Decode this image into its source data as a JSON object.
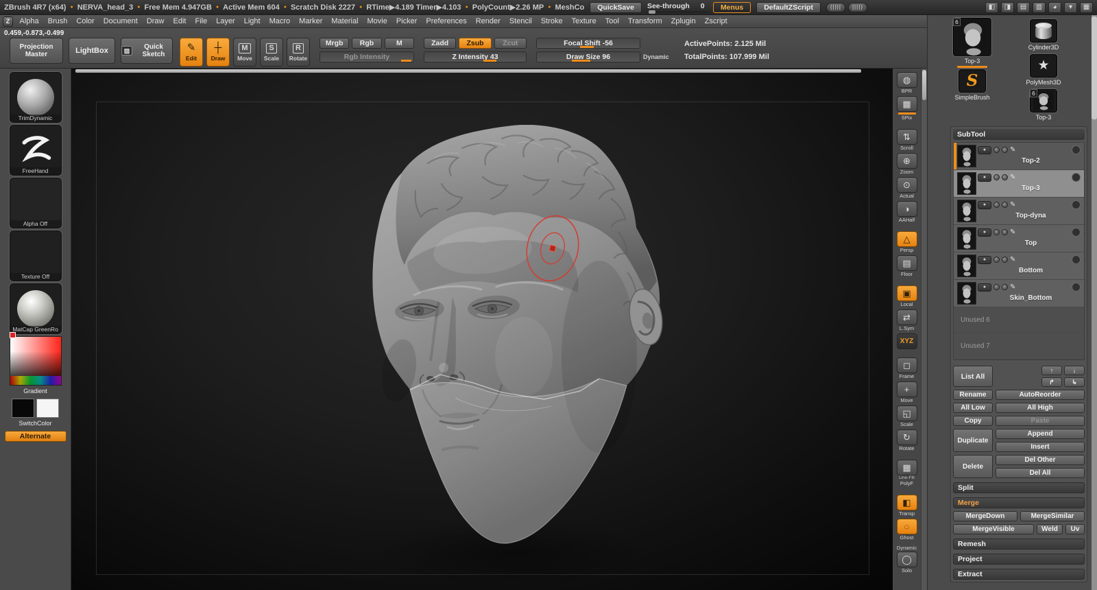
{
  "colors": {
    "accent": "#ef8f1c",
    "cursor_red": "#d63a2c"
  },
  "title_bar": {
    "stats": [
      "ZBrush 4R7 (x64)",
      "NERVA_head_3",
      "Free Mem 4.947GB",
      "Active Mem 604",
      "Scratch Disk 2227",
      "RTime▶4.189 Timer▶4.103",
      "PolyCount▶2.26 MP",
      "MeshCo"
    ],
    "stat_separator": "●",
    "quicksave": "QuickSave",
    "see_through_label": "See-through",
    "see_through_value": "0",
    "menus": "Menus",
    "default_zscript": "DefaultZScript",
    "zscript_sliders": [
      "(||||",
      "||||)"
    ]
  },
  "window_icons": [
    {
      "name": "document-new-icon",
      "glyph": "◧"
    },
    {
      "name": "document-save-icon",
      "glyph": "◨"
    },
    {
      "name": "document-open-icon",
      "glyph": "▤"
    },
    {
      "name": "document-export-icon",
      "glyph": "▥"
    },
    {
      "name": "material-sphere-icon",
      "glyph": "◕"
    },
    {
      "name": "collapse-tray-icon",
      "glyph": "▾"
    },
    {
      "name": "grid-icon",
      "glyph": "▦"
    }
  ],
  "menu_bar": {
    "logo_glyph": "Z",
    "items": [
      "Alpha",
      "Brush",
      "Color",
      "Document",
      "Draw",
      "Edit",
      "File",
      "Layer",
      "Light",
      "Macro",
      "Marker",
      "Material",
      "Movie",
      "Picker",
      "Preferences",
      "Render",
      "Stencil",
      "Stroke",
      "Texture",
      "Tool",
      "Transform",
      "Zplugin",
      "Zscript"
    ]
  },
  "coords_readout": "0.459,-0.873,-0.499",
  "top_shelf": {
    "projection_master": "Projection Master",
    "lightbox": "LightBox",
    "quick_sketch": "Quick Sketch",
    "quick_sketch_icon": "▨",
    "modes": [
      {
        "label": "Edit",
        "glyph": "✎",
        "active": true
      },
      {
        "label": "Draw",
        "glyph": "┼",
        "active": true
      },
      {
        "label": "Move",
        "glyph": "M",
        "active": false
      },
      {
        "label": "Scale",
        "glyph": "S",
        "active": false
      },
      {
        "label": "Rotate",
        "glyph": "R",
        "active": false
      }
    ],
    "paint_toggles": [
      {
        "label": "Mrgb"
      },
      {
        "label": "Rgb"
      },
      {
        "label": "M"
      }
    ],
    "rgb_intensity_label": "Rgb Intensity",
    "sculpt_toggles": [
      {
        "label": "Zadd"
      },
      {
        "label": "Zsub",
        "active": true
      },
      {
        "label": "Zcut",
        "dim": true
      }
    ],
    "z_intensity_label": "Z Intensity 43",
    "focal_shift_label": "Focal Shift -56",
    "draw_size_label": "Draw Size 96",
    "dynamic_label": "Dynamic",
    "active_points": "ActivePoints: 2.125 Mil",
    "total_points": "TotalPoints: 107.999 Mil"
  },
  "left_sidebar": {
    "brush_name": "TrimDynamic",
    "stroke_name": "FreeHand",
    "alpha_name": "Alpha Off",
    "texture_name": "Texture Off",
    "material_name": "MatCap GreenRo",
    "gradient_label": "Gradient",
    "switch_label": "SwitchColor",
    "alternate_label": "Alternate"
  },
  "right_shelf": {
    "dynamic_label": "Dynamic",
    "items": [
      {
        "label": "BPR",
        "glyph": "◍"
      },
      {
        "label": "SPix",
        "glyph": "▦",
        "underline": true
      },
      {
        "label": "Scroll",
        "glyph": "⇅",
        "gap": true
      },
      {
        "label": "Zoom",
        "glyph": "⊕"
      },
      {
        "label": "Actual",
        "glyph": "⊙"
      },
      {
        "label": "AAHalf",
        "glyph": "◑"
      },
      {
        "label": "Persp",
        "glyph": "△",
        "accent": true,
        "gap": true
      },
      {
        "label": "Floor",
        "glyph": "▤"
      },
      {
        "label": "Local",
        "glyph": "▣",
        "accent": true,
        "gap": true
      },
      {
        "label": "L.Sym",
        "glyph": "⇄"
      },
      {
        "label": "XYZ",
        "glyph": "XYZ",
        "accent_text": true
      },
      {
        "label": "Frame",
        "glyph": "◻",
        "gap": true
      },
      {
        "label": "Move",
        "glyph": "+"
      },
      {
        "label": "Scale",
        "glyph": "◱"
      },
      {
        "label": "Rotate",
        "glyph": "↻"
      },
      {
        "label": "PolyF",
        "glyph": "▦",
        "sub": "Line-Fill",
        "gap": true
      },
      {
        "label": "Transp",
        "glyph": "◧",
        "accent": true,
        "gap": true
      },
      {
        "label": "Ghost",
        "glyph": "◌",
        "accent": true
      },
      {
        "label": "Solo",
        "glyph": "◯",
        "dynamic_before": true
      }
    ]
  },
  "tool_panel": {
    "active_tool": {
      "label": "Top-3",
      "badge": "6"
    },
    "quick_items": [
      {
        "label": "Cylinder3D",
        "icon": "cylinder"
      },
      {
        "label": "PolyMesh3D",
        "icon": "star"
      },
      {
        "label": "SimpleBrush",
        "icon": "sbrush"
      },
      {
        "label": "Top-3",
        "icon": "head",
        "badge": "6"
      }
    ],
    "subtool": {
      "title": "SubTool",
      "rows": [
        {
          "name": "Top-2",
          "variant": "first"
        },
        {
          "name": "Top-3",
          "variant": "selected"
        },
        {
          "name": "Top-dyna",
          "variant": ""
        },
        {
          "name": "Top",
          "variant": ""
        },
        {
          "name": "Bottom",
          "variant": ""
        },
        {
          "name": "Skin_Bottom",
          "variant": ""
        }
      ],
      "unused": [
        "Unused 6",
        "Unused 7"
      ],
      "list_all": "List All",
      "arrows": [
        "↑",
        "↓",
        "↱",
        "↳"
      ],
      "buttons": {
        "rename": "Rename",
        "autoreorder": "AutoReorder",
        "all_low": "All Low",
        "all_high": "All High",
        "copy": "Copy",
        "paste": "Paste",
        "duplicate": "Duplicate",
        "append": "Append",
        "insert": "Insert",
        "delete": "Delete",
        "del_other": "Del Other",
        "del_all": "Del All",
        "merge_down": "MergeDown",
        "merge_similar": "MergeSimilar",
        "merge_visible": "MergeVisible",
        "weld": "Weld",
        "uv": "Uv"
      },
      "sections": {
        "split": "Split",
        "merge": "Merge",
        "remesh": "Remesh",
        "project": "Project",
        "extract": "Extract"
      }
    }
  }
}
